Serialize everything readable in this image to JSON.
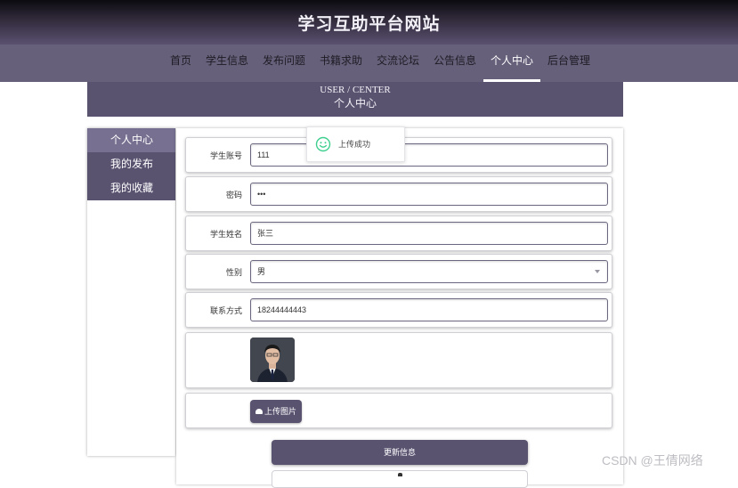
{
  "header": {
    "site_title": "学习互助平台网站"
  },
  "nav": {
    "items": [
      {
        "label": "首页"
      },
      {
        "label": "学生信息"
      },
      {
        "label": "发布问题"
      },
      {
        "label": "书籍求助"
      },
      {
        "label": "交流论坛"
      },
      {
        "label": "公告信息"
      },
      {
        "label": "个人中心"
      },
      {
        "label": "后台管理"
      }
    ],
    "active": "个人中心"
  },
  "banner": {
    "en": "USER / CENTER",
    "cn": "个人中心"
  },
  "sidebar": {
    "items": [
      {
        "label": "个人中心"
      },
      {
        "label": "我的发布"
      },
      {
        "label": "我的收藏"
      }
    ]
  },
  "form": {
    "fields": [
      {
        "label": "学生账号",
        "value": "111"
      },
      {
        "label": "密码",
        "value": "•••"
      },
      {
        "label": "学生姓名",
        "value": "张三"
      },
      {
        "label": "性别",
        "value": "男"
      },
      {
        "label": "联系方式",
        "value": "18244444443"
      }
    ],
    "upload_label": "上传图片",
    "submit_label": "更新信息"
  },
  "toast": {
    "text": "上传成功"
  },
  "watermark": "CSDN @王倩网络",
  "colors": {
    "primary": "#5a5370",
    "nav": "#67607a",
    "success": "#3ecf8e"
  }
}
